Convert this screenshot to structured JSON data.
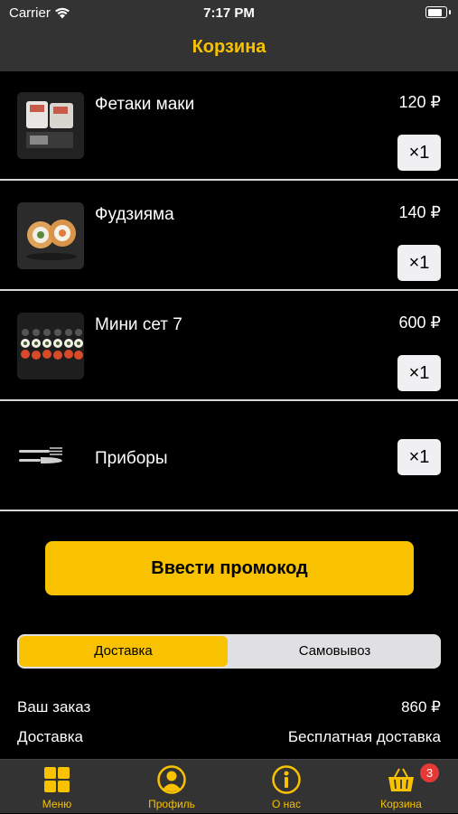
{
  "status_bar": {
    "carrier": "Carrier",
    "time": "7:17 PM",
    "battery_level": 0.95
  },
  "nav": {
    "title": "Корзина"
  },
  "cart_items": [
    {
      "name": "Фетаки маки",
      "price": "120 ₽",
      "quantity": "×1"
    },
    {
      "name": "Фудзияма",
      "price": "140 ₽",
      "quantity": "×1"
    },
    {
      "name": "Мини сет 7",
      "price": "600 ₽",
      "quantity": "×1"
    }
  ],
  "cutlery": {
    "name": "Приборы",
    "quantity": "×1",
    "icon": "cutlery-icon"
  },
  "promo_button": {
    "label": "Ввести промокод"
  },
  "delivery_toggle": {
    "options": [
      "Доставка",
      "Самовывоз"
    ],
    "selected": "Доставка"
  },
  "summary": {
    "order_label": "Ваш заказ",
    "order_total": "860 ₽",
    "delivery_label": "Доставка",
    "delivery_value": "Бесплатная доставка"
  },
  "tab_bar": {
    "tabs": [
      {
        "label": "Меню",
        "icon": "grid-icon"
      },
      {
        "label": "Профиль",
        "icon": "profile-icon"
      },
      {
        "label": "О нас",
        "icon": "info-icon"
      },
      {
        "label": "Корзина",
        "icon": "basket-icon",
        "badge": "3"
      }
    ],
    "active": "Корзина"
  },
  "colors": {
    "accent": "#f8c200",
    "bars": "#333333",
    "background": "#000000",
    "badge": "#e53935"
  }
}
